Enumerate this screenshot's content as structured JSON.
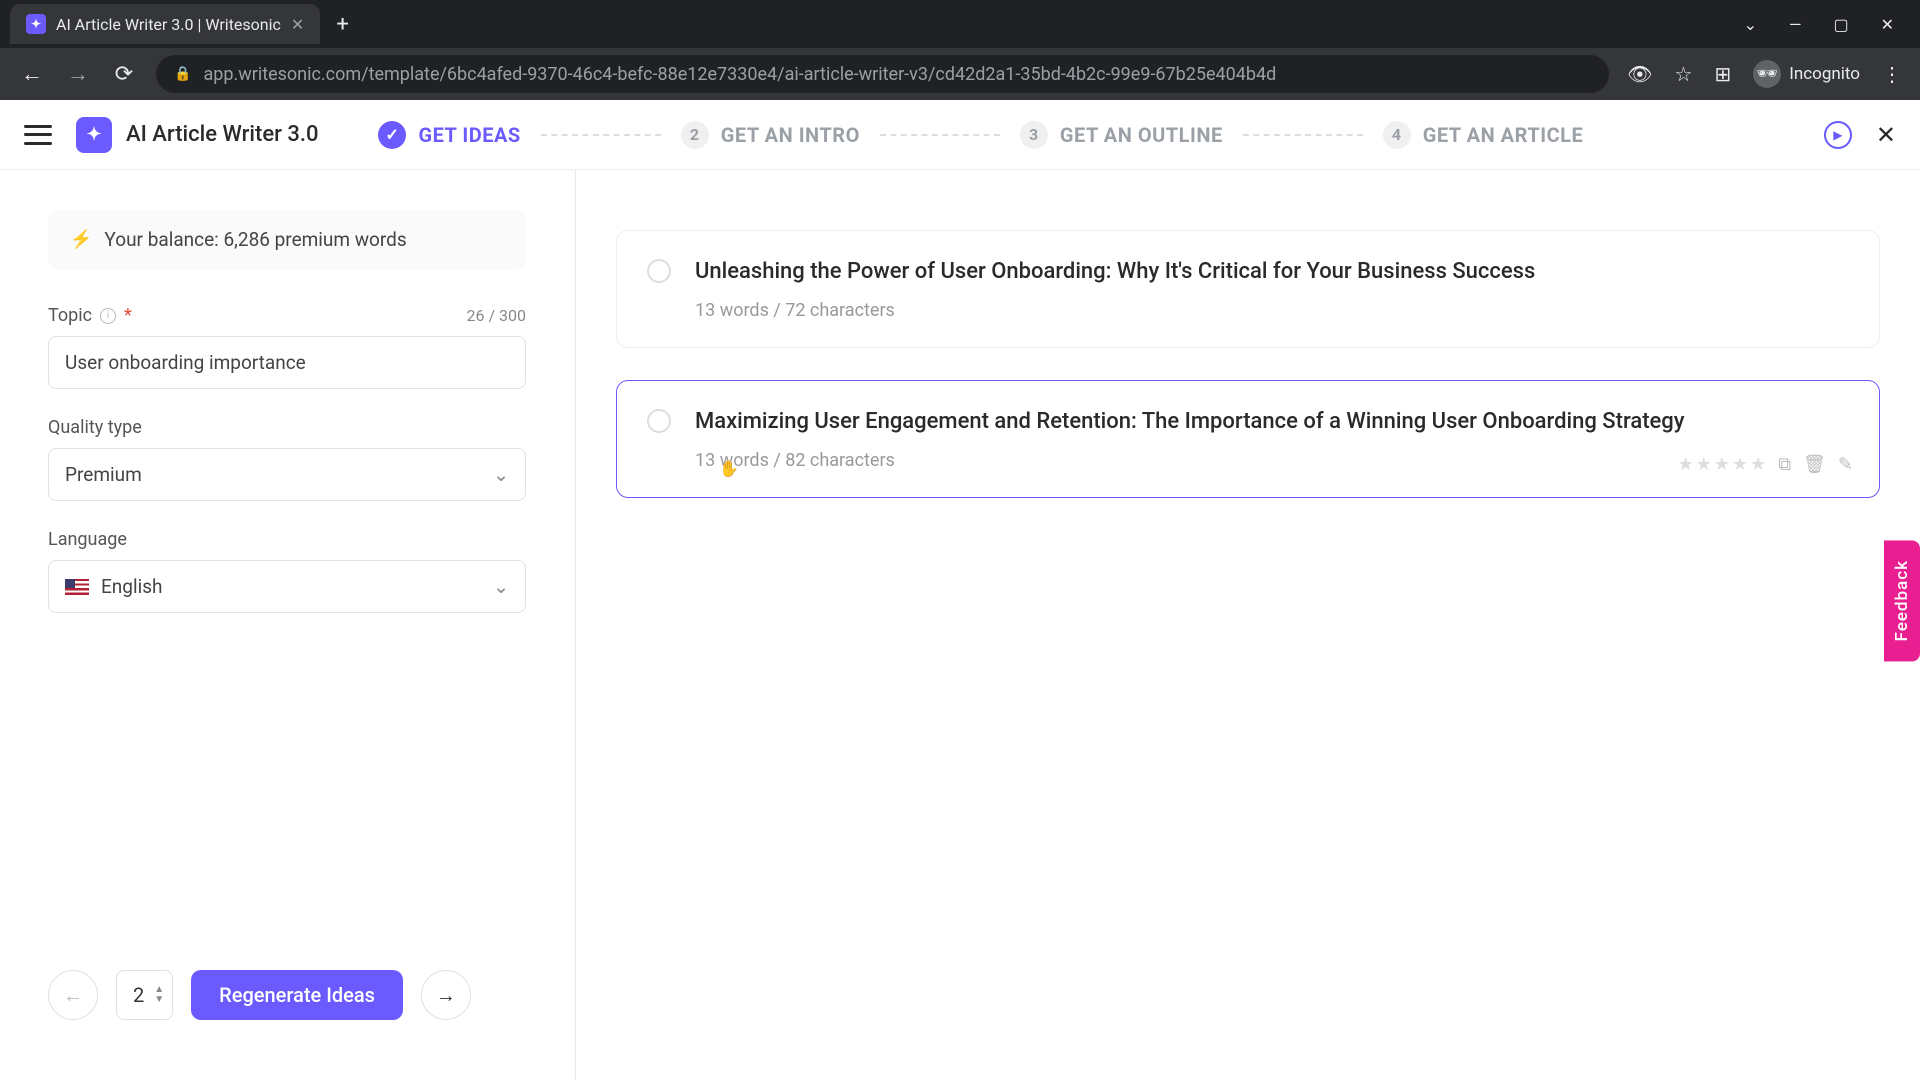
{
  "browser": {
    "tab_title": "AI Article Writer 3.0 | Writesonic",
    "url": "app.writesonic.com/template/6bc4afed-9370-46c4-befc-88e12e7330e4/ai-article-writer-v3/cd42d2a1-35bd-4b2c-99e9-67b25e404b4d",
    "incognito_label": "Incognito"
  },
  "header": {
    "app_title": "AI Article Writer 3.0",
    "steps": [
      {
        "num": "✓",
        "label": "GET IDEAS",
        "active": true,
        "checked": true
      },
      {
        "num": "2",
        "label": "GET AN INTRO",
        "active": false
      },
      {
        "num": "3",
        "label": "GET AN OUTLINE",
        "active": false
      },
      {
        "num": "4",
        "label": "GET AN ARTICLE",
        "active": false
      }
    ]
  },
  "sidebar": {
    "balance_text": "Your balance: 6,286 premium words",
    "topic_label": "Topic",
    "topic_counter": "26 / 300",
    "topic_value": "User onboarding importance",
    "quality_label": "Quality type",
    "quality_value": "Premium",
    "language_label": "Language",
    "language_value": "English",
    "count_value": "2",
    "regenerate_label": "Regenerate Ideas"
  },
  "ideas": [
    {
      "title": "Unleashing the Power of User Onboarding: Why It's Critical for Your Business Success",
      "meta": "13 words / 72 characters",
      "hovered": false
    },
    {
      "title": "Maximizing User Engagement and Retention: The Importance of a Winning User Onboarding Strategy",
      "meta": "13 words / 82 characters",
      "hovered": true
    }
  ],
  "feedback_label": "Feedback"
}
